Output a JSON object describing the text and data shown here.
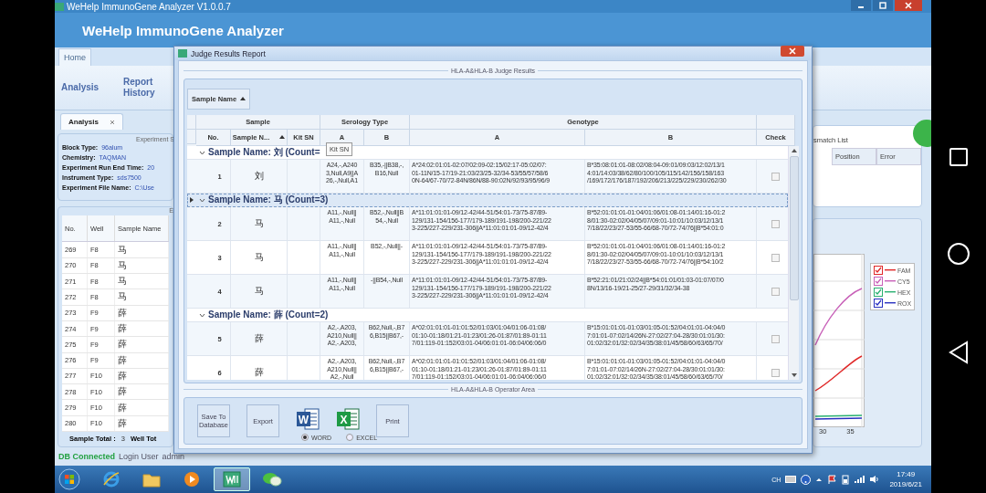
{
  "app": {
    "title": "WeHelp ImmunoGene Analyzer  V1.0.0.7",
    "header": "WeHelp ImmunoGene Analyzer",
    "ribbon_tabs": [
      {
        "label": "Home",
        "selected": true
      }
    ],
    "ribbon_buttons": [
      "Analysis",
      "Report History"
    ],
    "doc_tabs": [
      {
        "label": "Analysis",
        "selected": true
      }
    ],
    "experiment": {
      "legend": "Experiment S",
      "fields": [
        {
          "label": "Block Type:",
          "value": "96alum"
        },
        {
          "label": "Chemistry:",
          "value": "TAQMAN"
        },
        {
          "label": "Experiment Run End Time:",
          "value": "20"
        },
        {
          "label": "Instrument Type:",
          "value": "sds7500"
        },
        {
          "label": "Experiment File Name:",
          "value": "C:\\Use"
        }
      ]
    },
    "samples": {
      "legend": "E",
      "columns": [
        "No.",
        "Well",
        "Sample Name"
      ],
      "rows": [
        [
          "269",
          "F8",
          "马"
        ],
        [
          "270",
          "F8",
          "马"
        ],
        [
          "271",
          "F8",
          "马"
        ],
        [
          "272",
          "F8",
          "马"
        ],
        [
          "273",
          "F9",
          "薛"
        ],
        [
          "274",
          "F9",
          "薛"
        ],
        [
          "275",
          "F9",
          "薛"
        ],
        [
          "276",
          "F9",
          "薛"
        ],
        [
          "277",
          "F10",
          "薛"
        ],
        [
          "278",
          "F10",
          "薛"
        ],
        [
          "279",
          "F10",
          "薛"
        ],
        [
          "280",
          "F10",
          "薛"
        ]
      ],
      "sample_total_label": "Sample Total :",
      "sample_total": "3",
      "well_total_label": "Well Tot"
    },
    "mismatch": {
      "legend": "smatch List",
      "columns": [
        "Position",
        "Error"
      ]
    },
    "chart": {
      "legend": [
        {
          "name": "FAM",
          "color": "#e02828",
          "checked": true
        },
        {
          "name": "CY5",
          "color": "#c860b8",
          "checked": true
        },
        {
          "name": "HEX",
          "color": "#28b070",
          "checked": true
        },
        {
          "name": "ROX",
          "color": "#2830c0",
          "checked": true
        }
      ],
      "x_tick_labels": [
        "30",
        "35"
      ]
    },
    "status": {
      "db": "DB Connected",
      "login_label": "Login User",
      "login_user": "admin"
    }
  },
  "dialog": {
    "title": "Judge Results Report",
    "results_legend": "HLA-A&HLA-B Judge Results",
    "group_by": {
      "label": "Sample Name",
      "sorted": true
    },
    "column_groups": [
      {
        "label": "Sample",
        "columns": [
          {
            "label": "No.",
            "sorted": false
          },
          {
            "label": "Sample N...",
            "sorted": true
          },
          {
            "label": "Kit SN",
            "sorted": false
          }
        ]
      },
      {
        "label": "Serology Type",
        "columns": [
          {
            "label": "A",
            "sorted": false
          },
          {
            "label": "B",
            "sorted": false
          }
        ]
      },
      {
        "label": "Genotype",
        "columns": [
          {
            "label": "A",
            "sorted": false
          },
          {
            "label": "B",
            "sorted": false
          }
        ]
      },
      {
        "columns": [
          {
            "label": "Check",
            "sorted": false
          }
        ]
      }
    ],
    "tooltip": "Kit SN",
    "groups": [
      {
        "label": "Sample Name: 刘 (Count=",
        "expanded": true,
        "selected": false,
        "rows": [
          {
            "no": "1",
            "name": "刘",
            "serology_a": [
              "A24,-,A240",
              "3,Null,A9||A",
              "26,-,Null,A1"
            ],
            "serology_b": [
              "B35,-||B38,-,",
              "B16,Null"
            ],
            "genotype_a": [
              "A*24:02:01:01-02:07/02:09-02:15/02:17-05:02/07:",
              "01-11N/15-17/19-21:03/23/25-32/34-53/55/57/58/6",
              "0N-64/67-70/72-84N/86N/88-90:02N/92/93/95/96/9"
            ],
            "genotype_b": [
              "B*35:08:01:01-08:02/08:04-09:01/09:03/12:02/13/1",
              "4:01/14:03/38/62/80/100/105/115/142/156/158/163",
              "/169/172/176/187/192/206/213/225/229/230/262/30"
            ],
            "checked": false
          }
        ]
      },
      {
        "label": "Sample Name: 马 (Count=3)",
        "expanded": true,
        "selected": true,
        "rows": [
          {
            "no": "2",
            "name": "马",
            "serology_a": [
              "A11,-,Null||",
              "A11,-,Null"
            ],
            "serology_b": [
              "B52,-,Null||B",
              "54,-,Null"
            ],
            "genotype_a": [
              "A*11:01:01:01-09/12-42/44-51/54:01-73/75-87/89-",
              "129/131-154/156-177/179-189/191-198/200-221/22",
              "3-225/227-229/231-306||A*11:01:01:01-09/12-42/4"
            ],
            "genotype_b": [
              "B*52:01:01:01-01:04/01:06/01:08-01:14/01:16-01:2",
              "8/01:30-02:02/04/05/07/09:01-10:01/10:03/12/13/1",
              "7/18/22/23/27-53/55-66/68-70/72-74/76||B*54:01:0"
            ],
            "checked": false
          },
          {
            "no": "3",
            "name": "马",
            "serology_a": [
              "A11,-,Null||",
              "A11,-,Null"
            ],
            "serology_b": [
              "B52,-,Null||-"
            ],
            "genotype_a": [
              "A*11:01:01:01-09/12-42/44-51/54:01-73/75-87/89-",
              "129/131-154/156-177/179-189/191-198/200-221/22",
              "3-225/227-229/231-306||A*11:01:01:01-09/12-42/4"
            ],
            "genotype_b": [
              "B*52:01:01:01-01:04/01:06/01:08-01:14/01:16-01:2",
              "8/01:30-02:02/04/05/07/09:01-10:01/10:03/12/13/1",
              "7/18/22/23/27-53/55-66/68-70/72-74/76||B*54:10/2"
            ],
            "checked": false
          },
          {
            "no": "4",
            "name": "马",
            "serology_a": [
              "A11,-,Null||",
              "A11,-,Null"
            ],
            "serology_b": [
              "-||B54,-,Null"
            ],
            "genotype_a": [
              "A*11:01:01:01-09/12-42/44-51/54:01-73/75-87/89-",
              "129/131-154/156-177/179-189/191-198/200-221/22",
              "3-225/227-229/231-306||A*11:01:01:01-09/12-42/4"
            ],
            "genotype_b": [
              "B*52:21:01/21:02/24||B*54:01:01/01:03-01:07/07/0",
              "8N/13/16-19/21-25/27-29/31/32/34-38"
            ],
            "checked": false
          }
        ]
      },
      {
        "label": "Sample Name: 薛 (Count=2)",
        "expanded": true,
        "selected": false,
        "rows": [
          {
            "no": "5",
            "name": "薛",
            "serology_a": [
              "A2,-,A203,",
              "A210,Null||",
              "A2,-,A203,"
            ],
            "serology_b": [
              "B62,Null,-,B7",
              "6,B15||B67,-"
            ],
            "genotype_a": [
              "A*02:01:01:01-01:01:52/01:03/01:04/01:06-01:08/",
              "01:10-01:18/01:21-01:23/01:26-01:87/01:89-01:11",
              "7/01:119-01:152/03:01-04/06:01:01-06:04/06:06/0"
            ],
            "genotype_b": [
              "B*15:01:01:01-01:03/01:05-01:52/04:01:01-04:04/0",
              "7:01:01-07:02/14/26N-27:02/27:04-28/30:01:01/30:",
              "01:02/32:01/32:02/34/35/38:01/45/58/60/63/65/70/"
            ],
            "checked": false
          },
          {
            "no": "6",
            "name": "薛",
            "serology_a": [
              "A2,-,A203,",
              "A210,Null||",
              "A2,-,Null"
            ],
            "serology_b": [
              "B62,Null,-,B7",
              "6,B15||B67,-"
            ],
            "genotype_a": [
              "A*02:01:01:01-01:01:52/01:03/01:04/01:06-01:08/",
              "01:10-01:18/01:21-01:23/01:26-01:87/01:89-01:11",
              "7/01:119-01:152/03:01-04/06:01:01-06:04/06:06/0"
            ],
            "genotype_b": [
              "B*15:01:01:01-01:03/01:05-01:52/04:01:01-04:04/0",
              "7:01:01-07:02/14/26N-27:02/27:04-28/30:01:01/30:",
              "01:02/32:01/32:02/34/35/38:01/45/58/60/63/65/70/"
            ],
            "checked": false
          }
        ]
      }
    ],
    "operator_legend": "HLA-A&HLA-B Operator Area",
    "buttons": [
      {
        "kind": "button",
        "label": "Save To Database"
      },
      {
        "kind": "button",
        "label": "Export"
      },
      {
        "kind": "word",
        "glyph": "W"
      },
      {
        "kind": "excel",
        "glyph": "X"
      },
      {
        "kind": "button",
        "label": "Print"
      }
    ],
    "formats": [
      {
        "label": "WORD",
        "selected": true
      },
      {
        "label": "EXCEL",
        "selected": false
      }
    ]
  },
  "taskbar": {
    "apps": [
      {
        "kind": "ie",
        "active": false
      },
      {
        "kind": "folder",
        "active": false
      },
      {
        "kind": "media",
        "active": false
      },
      {
        "kind": "app",
        "active": true
      },
      {
        "kind": "chat",
        "active": false
      }
    ],
    "tray": {
      "lang": "CH",
      "time": "17:49",
      "date": "2019/6/21"
    }
  }
}
